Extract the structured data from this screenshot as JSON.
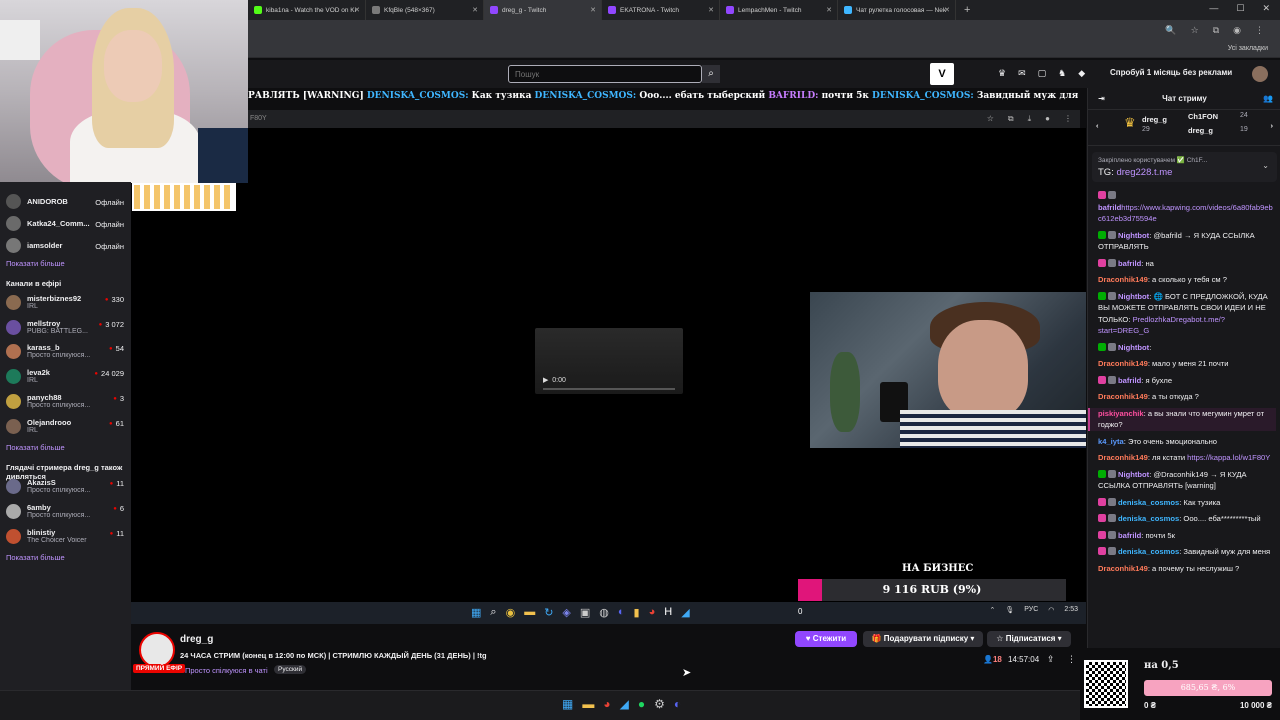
{
  "browser_tabs": [
    {
      "label": "kiba1na - Watch the VOD on Ki",
      "color": "#53fc18",
      "active": false
    },
    {
      "label": "KfqBle (548×367)",
      "color": "#7a7a7a",
      "active": false
    },
    {
      "label": "dreg_g - Twitch",
      "color": "#9147ff",
      "active": true
    },
    {
      "label": "EKATRONA - Twitch",
      "color": "#9147ff",
      "active": false
    },
    {
      "label": "LempachMen - Twitch",
      "color": "#9147ff",
      "active": false
    },
    {
      "label": "Чат рулетка голосовая — Nek",
      "color": "#3fb6ff",
      "active": false
    }
  ],
  "bookmarks_label": "Усі закладки",
  "search": {
    "placeholder": "Пошук"
  },
  "promo": "Спробуй 1 місяць без реклами",
  "ticker": {
    "p1": "РАВЛЯТЬ [WARNING] ",
    "n1": "DENISKA_COSMOS:",
    "t1": " Как тузика ",
    "n2": "DENISKA_COSMOS:",
    "t2": " Ооо.... ебать тыберский ",
    "n3": "BAFRILD:",
    "t3": " почти 5к ",
    "n4": "DENISKA_COSMOS:",
    "t4": " Завидный муж для меня"
  },
  "inner_addr": "F80Y",
  "player_time": "0:00",
  "goal": {
    "title": "НА БИЗНЕС",
    "text": "9 116 RUB (9%)",
    "percent": 9
  },
  "stream_taskbar": {
    "zero": "0",
    "lang": "РУС",
    "time": "2:53"
  },
  "sidebar": {
    "offline": [
      {
        "name": "ANIDOROB",
        "status": "Офлайн",
        "color": "#555"
      },
      {
        "name": "Katka24_Comm...",
        "status": "Офлайн",
        "color": "#6a6a6a"
      },
      {
        "name": "iamsolder",
        "status": "Офлайн",
        "color": "#777"
      }
    ],
    "show_more_1": "Показати більше",
    "live_header": "Канали в ефірі",
    "live": [
      {
        "name": "misterbiznes92",
        "sub": "IRL",
        "viewers": "330",
        "color": "#8a6a50"
      },
      {
        "name": "mellstroy",
        "sub": "PUBG: BATTLEG...",
        "viewers": "3 072",
        "color": "#6a4fa0"
      },
      {
        "name": "karass_b",
        "sub": "Просто спілкуюся...",
        "viewers": "54",
        "color": "#b07050"
      },
      {
        "name": "leva2k",
        "sub": "IRL",
        "viewers": "24 029",
        "color": "#1d7a5a"
      },
      {
        "name": "panych88",
        "sub": "Просто спілкуюся...",
        "viewers": "3",
        "color": "#c0a040"
      },
      {
        "name": "Olejandrooo",
        "sub": "IRL",
        "viewers": "61",
        "color": "#7a6050"
      }
    ],
    "show_more_2": "Показати більше",
    "watch_header": "Глядачі стримера dreg_g також дивляться",
    "watch": [
      {
        "name": "AkazisS",
        "sub": "Просто спілкуюся...",
        "viewers": "11",
        "color": "#6a6a8a"
      },
      {
        "name": "6amby",
        "sub": "Просто спілкуюся...",
        "viewers": "6",
        "color": "#aaa"
      },
      {
        "name": "blinistiy",
        "sub": "The Choicer Voicer",
        "viewers": "11",
        "color": "#c05030"
      }
    ],
    "show_more_3": "Показати більше"
  },
  "info": {
    "channel": "dreg_g",
    "title": "24 ЧАСА СТРИМ (конец в 12:00 по МСК) | СТРИМЛЮ КАЖДЫЙ ДЕНЬ (31 ДЕНЬ) | !tg",
    "live_badge": "ПРЯМИЙ ЕФІР",
    "category": "Просто спілкуюся в чаті",
    "tag": "Русский",
    "follow": "♥ Стежити",
    "gift": "🎁 Подарувати підписку ▾",
    "subscribe": "☆ Підписатися ▾",
    "viewers": "18",
    "uptime": "14:57:04"
  },
  "chat": {
    "header": "Чат стриму",
    "leader": [
      {
        "name": "dreg_g",
        "count": "29"
      },
      {
        "name": "Ch1FON",
        "count": "24"
      },
      {
        "name": "dreg_g",
        "count": "19"
      }
    ],
    "pinned_by": "Закріплено користувачем ✅ Ch1F...",
    "pinned_text": "TG: ",
    "pinned_link": "dreg228.t.me",
    "messages": [
      {
        "user": "bafrild",
        "color": "#bf94ff",
        "text": "",
        "link": "https://www.kapwing.com/videos/6a80fab9ebc612eb3d75594e",
        "badge": "#e040a0"
      },
      {
        "user": "Nightbot",
        "color": "#bf94ff",
        "text": ": @bafrild → Я КУДА ССЫЛКА ОТПРАВЛЯТЬ",
        "link": "",
        "badge": "#00ad03"
      },
      {
        "user": "bafrild",
        "color": "#bf94ff",
        "text": ": на",
        "link": "",
        "badge": "#e040a0"
      },
      {
        "user": "Draconhik149",
        "color": "#ff7a5a",
        "text": ": а сколько у тебя см ?",
        "link": "",
        "badge": ""
      },
      {
        "user": "Nightbot",
        "color": "#bf94ff",
        "text": ": 🌐 БОТ С ПРЕДЛОЖКОЙ, КУДА ВЫ МОЖЕТЕ ОТПРАВЛЯТЬ СВОИ ИДЕИ И НЕ ТОЛЬКО: ",
        "link": "PredlozhkaDregabot.t.me/?start=DREG_G",
        "badge": "#00ad03"
      },
      {
        "user": "Nightbot",
        "color": "#bf94ff",
        "text": ":",
        "link": "",
        "badge": "#00ad03"
      },
      {
        "user": "Draconhik149",
        "color": "#ff7a5a",
        "text": ": мало у меня 21 почти",
        "link": "",
        "badge": ""
      },
      {
        "user": "bafrild",
        "color": "#bf94ff",
        "text": ": я бухле",
        "link": "",
        "badge": "#e040a0"
      },
      {
        "user": "Draconhik149",
        "color": "#ff7a5a",
        "text": ": а ты откуда ?",
        "link": "",
        "badge": ""
      },
      {
        "user": "piskiyanchik",
        "color": "#ff4fa0",
        "text": ": а вы знали что мегумин умрет от годжо?",
        "link": "",
        "badge": "",
        "hl": true
      },
      {
        "user": "k4_iyta",
        "color": "#5a9aff",
        "text": ": Это очень эмоционально",
        "link": "",
        "badge": ""
      },
      {
        "user": "Draconhik149",
        "color": "#ff7a5a",
        "text": ": ля кстати ",
        "link": "https://kappa.lol/w1F80Y",
        "badge": ""
      },
      {
        "user": "Nightbot",
        "color": "#bf94ff",
        "text": ": @Draconhik149 → Я КУДА ССЫЛКА ОТПРАВЛЯТЬ [warning]",
        "link": "",
        "badge": "#00ad03"
      },
      {
        "user": "deniska_cosmos",
        "color": "#3fb6ff",
        "text": ": Как тузика",
        "link": "",
        "badge": "#e040a0"
      },
      {
        "user": "deniska_cosmos",
        "color": "#3fb6ff",
        "text": ": Ооо.... еба*********тый",
        "link": "",
        "badge": "#e040a0"
      },
      {
        "user": "bafrild",
        "color": "#bf94ff",
        "text": ": почти 5к",
        "link": "",
        "badge": "#e040a0"
      },
      {
        "user": "deniska_cosmos",
        "color": "#3fb6ff",
        "text": ": Завидный муж для меня",
        "link": "",
        "badge": "#e040a0"
      },
      {
        "user": "Draconhik149",
        "color": "#ff7a5a",
        "text": ": а почему ты неслужиш ?",
        "link": "",
        "badge": ""
      }
    ]
  },
  "donate": {
    "title": "на 0,5",
    "bar_text": "685,65 ₴, 6%",
    "min": "0 ₴",
    "max": "10 000 ₴"
  }
}
